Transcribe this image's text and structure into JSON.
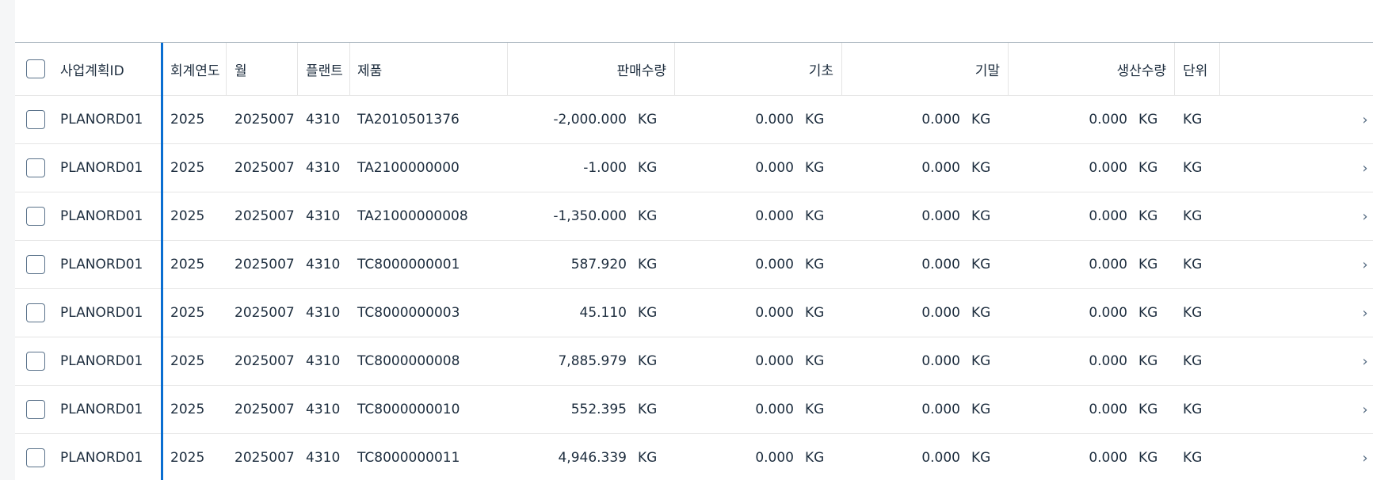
{
  "table": {
    "headers": {
      "plan_id": "사업계획ID",
      "fiscal_year": "회계연도",
      "month": "월",
      "plant": "플랜트",
      "product": "제품",
      "sales_qty": "판매수량",
      "opening": "기초",
      "closing": "기말",
      "production_qty": "생산수량",
      "unit": "단위"
    },
    "rows": [
      {
        "plan_id": "PLANORD01",
        "fiscal_year": "2025",
        "month": "2025007",
        "plant": "4310",
        "product": "TA2010501376",
        "sales_qty": "-2,000.000",
        "sales_unit": "KG",
        "opening": "0.000",
        "opening_unit": "KG",
        "closing": "0.000",
        "closing_unit": "KG",
        "production_qty": "0.000",
        "production_unit": "KG",
        "unit": "KG"
      },
      {
        "plan_id": "PLANORD01",
        "fiscal_year": "2025",
        "month": "2025007",
        "plant": "4310",
        "product": "TA2100000000",
        "sales_qty": "-1.000",
        "sales_unit": "KG",
        "opening": "0.000",
        "opening_unit": "KG",
        "closing": "0.000",
        "closing_unit": "KG",
        "production_qty": "0.000",
        "production_unit": "KG",
        "unit": "KG"
      },
      {
        "plan_id": "PLANORD01",
        "fiscal_year": "2025",
        "month": "2025007",
        "plant": "4310",
        "product": "TA21000000008",
        "sales_qty": "-1,350.000",
        "sales_unit": "KG",
        "opening": "0.000",
        "opening_unit": "KG",
        "closing": "0.000",
        "closing_unit": "KG",
        "production_qty": "0.000",
        "production_unit": "KG",
        "unit": "KG"
      },
      {
        "plan_id": "PLANORD01",
        "fiscal_year": "2025",
        "month": "2025007",
        "plant": "4310",
        "product": "TC8000000001",
        "sales_qty": "587.920",
        "sales_unit": "KG",
        "opening": "0.000",
        "opening_unit": "KG",
        "closing": "0.000",
        "closing_unit": "KG",
        "production_qty": "0.000",
        "production_unit": "KG",
        "unit": "KG"
      },
      {
        "plan_id": "PLANORD01",
        "fiscal_year": "2025",
        "month": "2025007",
        "plant": "4310",
        "product": "TC8000000003",
        "sales_qty": "45.110",
        "sales_unit": "KG",
        "opening": "0.000",
        "opening_unit": "KG",
        "closing": "0.000",
        "closing_unit": "KG",
        "production_qty": "0.000",
        "production_unit": "KG",
        "unit": "KG"
      },
      {
        "plan_id": "PLANORD01",
        "fiscal_year": "2025",
        "month": "2025007",
        "plant": "4310",
        "product": "TC8000000008",
        "sales_qty": "7,885.979",
        "sales_unit": "KG",
        "opening": "0.000",
        "opening_unit": "KG",
        "closing": "0.000",
        "closing_unit": "KG",
        "production_qty": "0.000",
        "production_unit": "KG",
        "unit": "KG"
      },
      {
        "plan_id": "PLANORD01",
        "fiscal_year": "2025",
        "month": "2025007",
        "plant": "4310",
        "product": "TC8000000010",
        "sales_qty": "552.395",
        "sales_unit": "KG",
        "opening": "0.000",
        "opening_unit": "KG",
        "closing": "0.000",
        "closing_unit": "KG",
        "production_qty": "0.000",
        "production_unit": "KG",
        "unit": "KG"
      },
      {
        "plan_id": "PLANORD01",
        "fiscal_year": "2025",
        "month": "2025007",
        "plant": "4310",
        "product": "TC8000000011",
        "sales_qty": "4,946.339",
        "sales_unit": "KG",
        "opening": "0.000",
        "opening_unit": "KG",
        "closing": "0.000",
        "closing_unit": "KG",
        "production_qty": "0.000",
        "production_unit": "KG",
        "unit": "KG"
      }
    ],
    "nav_glyph": "›",
    "icons": {
      "row_checkbox": "checkbox-icon",
      "row_navigation": "chevron-right-icon"
    },
    "colors": {
      "freeze_line": "#0a6ed1",
      "row_border": "#e5e5e5",
      "header_border": "#a9b4be"
    }
  }
}
